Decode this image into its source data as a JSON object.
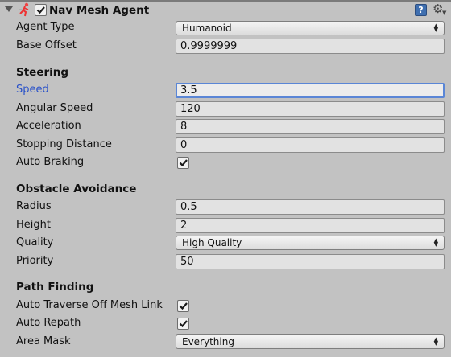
{
  "component": {
    "title": "Nav Mesh Agent",
    "enabled": true,
    "icons": {
      "foldout": "foldout-arrow-icon",
      "component": "nav-mesh-agent-icon",
      "help": "help-icon",
      "settings": "gear-icon"
    }
  },
  "agent_type": {
    "label": "Agent Type",
    "value": "Humanoid"
  },
  "base_offset": {
    "label": "Base Offset",
    "value": "0.9999999"
  },
  "steering": {
    "heading": "Steering",
    "speed": {
      "label": "Speed",
      "value": "3.5"
    },
    "angular_speed": {
      "label": "Angular Speed",
      "value": "120"
    },
    "acceleration": {
      "label": "Acceleration",
      "value": "8"
    },
    "stopping_distance": {
      "label": "Stopping Distance",
      "value": "0"
    },
    "auto_braking": {
      "label": "Auto Braking",
      "checked": true
    }
  },
  "obstacle_avoidance": {
    "heading": "Obstacle Avoidance",
    "radius": {
      "label": "Radius",
      "value": "0.5"
    },
    "height": {
      "label": "Height",
      "value": "2"
    },
    "quality": {
      "label": "Quality",
      "value": "High Quality"
    },
    "priority": {
      "label": "Priority",
      "value": "50"
    }
  },
  "path_finding": {
    "heading": "Path Finding",
    "auto_traverse": {
      "label": "Auto Traverse Off Mesh Link",
      "checked": true
    },
    "auto_repath": {
      "label": "Auto Repath",
      "checked": true
    },
    "area_mask": {
      "label": "Area Mask",
      "value": "Everything"
    }
  },
  "colors": {
    "background": "#c2c2c2",
    "focus_label": "#2a52c9",
    "focus_border": "#5a86d6"
  }
}
